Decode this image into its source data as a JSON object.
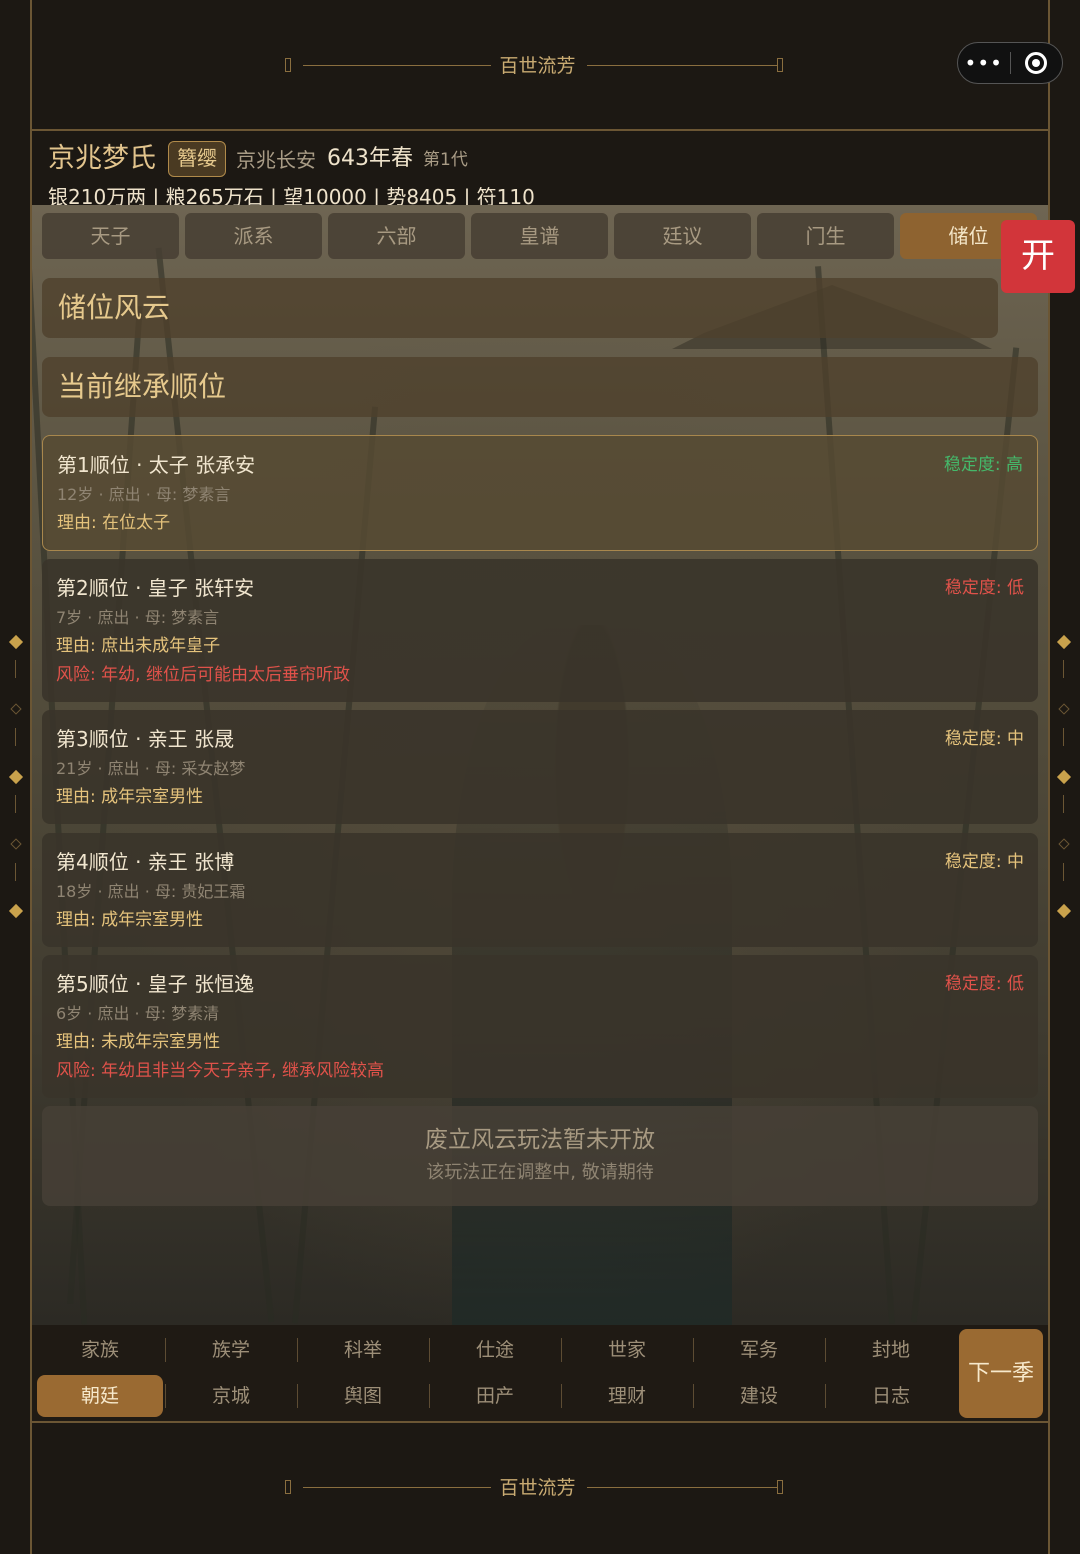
{
  "banner": {
    "top_title": "百世流芳",
    "bottom_title": "百世流芳"
  },
  "capsule": {
    "more_glyph": "•••"
  },
  "family": {
    "name": "京兆梦氏",
    "rank": "簪缨",
    "place": "京兆长安",
    "year": "643年春",
    "generation": "第1代",
    "stats": "银210万两 | 粮265万石 | 望10000 | 势8405 | 符110"
  },
  "tabs": [
    {
      "label": "天子",
      "active": false
    },
    {
      "label": "派系",
      "active": false
    },
    {
      "label": "六部",
      "active": false
    },
    {
      "label": "皇谱",
      "active": false
    },
    {
      "label": "廷议",
      "active": false
    },
    {
      "label": "门生",
      "active": false
    },
    {
      "label": "储位",
      "active": true
    }
  ],
  "open_button": "开",
  "section": {
    "title": "储位风云",
    "subtitle": "当前继承顺位"
  },
  "heirs": [
    {
      "name": "第1顺位 · 太子 张承安",
      "stability": "稳定度: 高",
      "stability_color": "#45b86a",
      "info": "12岁 · 庶出 · 母: 梦素言",
      "reason": "理由: 在位太子",
      "risk": ""
    },
    {
      "name": "第2顺位 · 皇子 张轩安",
      "stability": "稳定度: 低",
      "stability_color": "#e0524a",
      "info": "7岁 · 庶出 · 母: 梦素言",
      "reason": "理由: 庶出未成年皇子",
      "risk": "风险: 年幼, 继位后可能由太后垂帘听政"
    },
    {
      "name": "第3顺位 · 亲王 张晟",
      "stability": "稳定度: 中",
      "stability_color": "#e5c37c",
      "info": "21岁 · 庶出 · 母: 采女赵梦",
      "reason": "理由: 成年宗室男性",
      "risk": ""
    },
    {
      "name": "第4顺位 · 亲王 张博",
      "stability": "稳定度: 中",
      "stability_color": "#e5c37c",
      "info": "18岁 · 庶出 · 母: 贵妃王霜",
      "reason": "理由: 成年宗室男性",
      "risk": ""
    },
    {
      "name": "第5顺位 · 皇子 张恒逸",
      "stability": "稳定度: 低",
      "stability_color": "#e0524a",
      "info": "6岁 · 庶出 · 母: 梦素清",
      "reason": "理由: 未成年宗室男性",
      "risk": "风险: 年幼且非当今天子亲子, 继承风险较高"
    }
  ],
  "closed_notice": {
    "title": "废立风云玩法暂未开放",
    "subtitle": "该玩法正在调整中, 敬请期待"
  },
  "bottom_nav": {
    "row1": [
      "家族",
      "族学",
      "科举",
      "仕途",
      "世家",
      "军务",
      "封地"
    ],
    "row2": [
      "朝廷",
      "京城",
      "舆图",
      "田产",
      "理财",
      "建设",
      "日志"
    ],
    "active": "朝廷",
    "next_button": "下一季"
  },
  "colors": {
    "accent": "#9a6a32",
    "gold": "#e5c37c",
    "alert": "#d2353a"
  }
}
